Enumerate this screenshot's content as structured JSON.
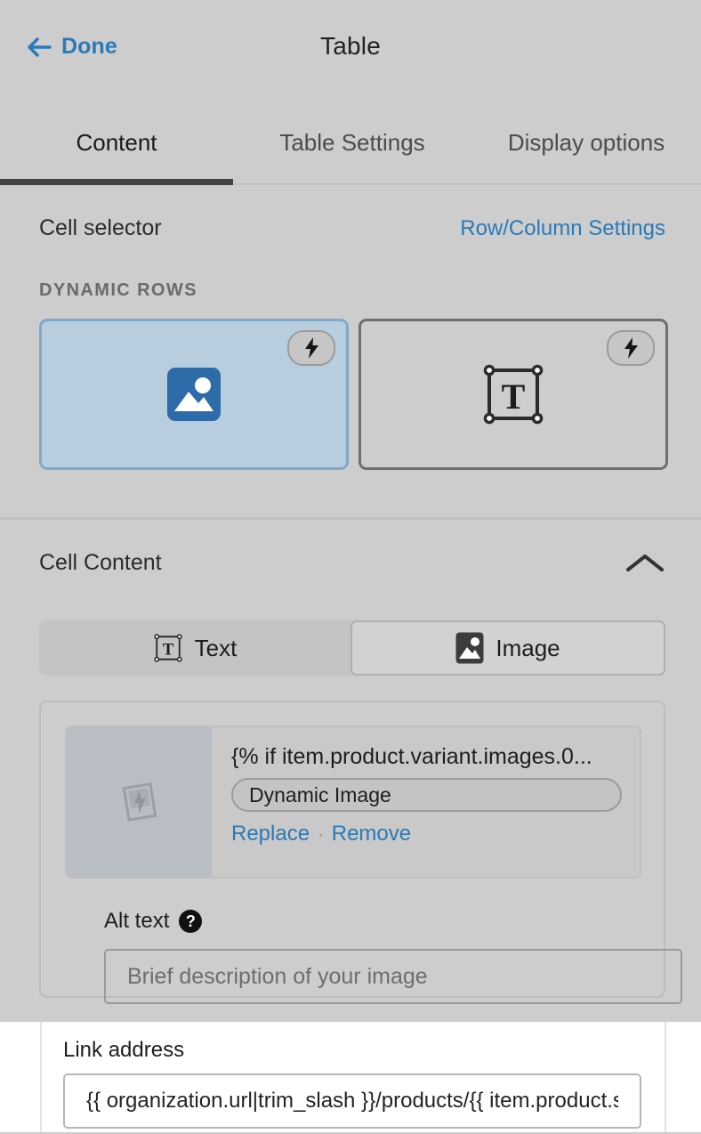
{
  "header": {
    "back_label": "Done",
    "back_icon": "arrow-left-icon",
    "title": "Table"
  },
  "tabs": [
    {
      "label": "Content",
      "active": true
    },
    {
      "label": "Table Settings",
      "active": false
    },
    {
      "label": "Display options",
      "active": false
    }
  ],
  "cell_selector": {
    "title": "Cell selector",
    "settings_link": "Row/Column Settings",
    "group_label": "DYNAMIC ROWS",
    "cards": [
      {
        "type": "image",
        "icon": "image-icon",
        "badge_icon": "lightning-bolt-icon",
        "selected": true
      },
      {
        "type": "text",
        "icon": "text-box-icon",
        "badge_icon": "lightning-bolt-icon",
        "selected": false
      }
    ]
  },
  "cell_content": {
    "title": "Cell Content",
    "collapse_icon": "chevron-up-icon",
    "segmented": {
      "options": [
        {
          "label": "Text",
          "icon": "text-box-icon",
          "selected": false
        },
        {
          "label": "Image",
          "icon": "image-icon",
          "selected": true
        }
      ]
    },
    "image_card": {
      "thumbnail_icon": "dynamic-image-placeholder-icon",
      "filename": "{% if item.product.variant.images.0...",
      "dynamic_pill_label": "Dynamic Image",
      "replace_label": "Replace",
      "separator": "·",
      "remove_label": "Remove"
    },
    "alt_text": {
      "label": "Alt text",
      "help_icon": "question-mark-icon",
      "help_glyph": "?",
      "value": "",
      "placeholder": "Brief description of your image"
    }
  },
  "link_address": {
    "label": "Link address",
    "value": "{{ organization.url|trim_slash }}/products/{{ item.product.slug }}",
    "placeholder": ""
  },
  "colors": {
    "page_bg": "#cdcdcd",
    "accent_blue": "#2a7ab8",
    "selected_card_bg": "#b8cede",
    "selected_card_border": "#7fa9c9",
    "icon_blue": "#2d6ca8",
    "tab_underline": "#434343",
    "sheet_bg": "#ffffff"
  }
}
